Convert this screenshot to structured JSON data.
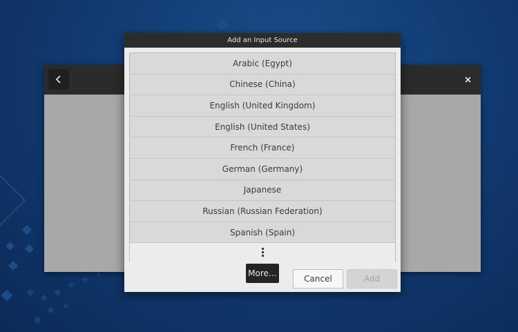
{
  "dialog": {
    "title": "Add an Input Source",
    "languages": [
      "Arabic (Egypt)",
      "Chinese (China)",
      "English (United Kingdom)",
      "English (United States)",
      "French (France)",
      "German (Germany)",
      "Japanese",
      "Russian (Russian Federation)",
      "Spanish (Spain)"
    ],
    "more_row_icon": "vertical-ellipsis-icon",
    "more_button": "More…",
    "cancel_button": "Cancel",
    "add_button": "Add"
  },
  "background_window": {
    "back_icon": "chevron-left-icon",
    "close_icon": "close-icon"
  },
  "colors": {
    "desktop": "#123c73",
    "titlebar": "#2c2c2c",
    "list_row": "#d9d9d9",
    "dialog": "#ececec"
  }
}
